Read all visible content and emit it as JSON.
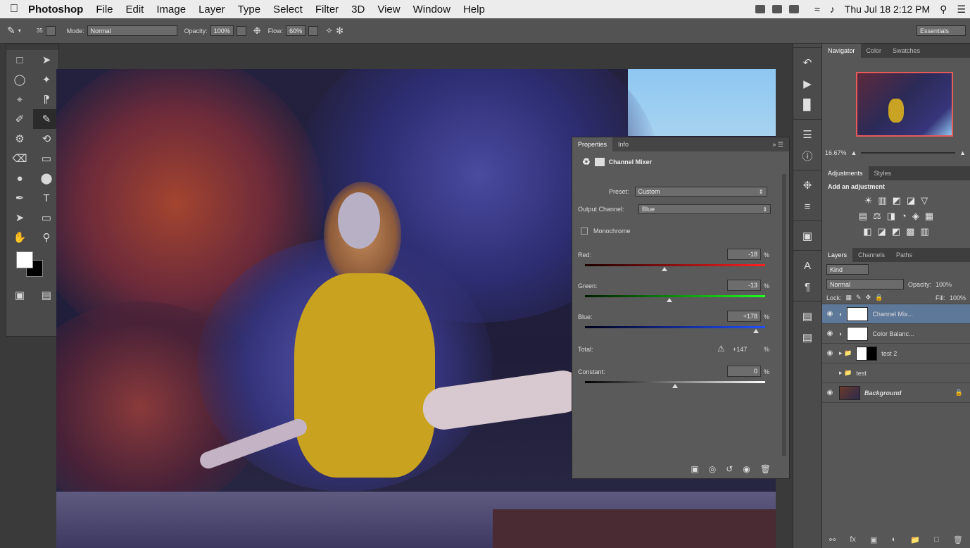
{
  "menubar": {
    "app_name": "Photoshop",
    "items": [
      "File",
      "Edit",
      "Image",
      "Layer",
      "Type",
      "Select",
      "Filter",
      "3D",
      "View",
      "Window",
      "Help"
    ],
    "clock": "Thu Jul 18  2:12 PM"
  },
  "options_bar": {
    "brush_size": "35",
    "mode_label": "Mode:",
    "mode_value": "Normal",
    "opacity_label": "Opacity:",
    "opacity_value": "100%",
    "flow_label": "Flow:",
    "flow_value": "60%",
    "workspace": "Essentials"
  },
  "properties_panel": {
    "tabs": [
      "Properties",
      "Info"
    ],
    "title": "Channel Mixer",
    "preset_label": "Preset:",
    "preset_value": "Custom",
    "output_label": "Output Channel:",
    "output_value": "Blue",
    "monochrome_label": "Monochrome",
    "sliders": [
      {
        "label": "Red:",
        "value": "-18",
        "thumb_fraction": 0.44,
        "gradient": "linear-gradient(90deg,#1a0000,#ff2020)"
      },
      {
        "label": "Green:",
        "value": "-13",
        "thumb_fraction": 0.47,
        "gradient": "linear-gradient(90deg,#001a00,#20ff20)"
      },
      {
        "label": "Blue:",
        "value": "+178",
        "thumb_fraction": 0.95,
        "gradient": "linear-gradient(90deg,#00001a,#2050ff)"
      }
    ],
    "total_label": "Total:",
    "total_value": "+147",
    "constant_label": "Constant:",
    "constant_value": "0",
    "constant_thumb_fraction": 0.5,
    "percent": "%"
  },
  "navigator": {
    "tabs": [
      "Navigator",
      "Color",
      "Swatches"
    ],
    "zoom": "16.67%"
  },
  "adjustments": {
    "tabs": [
      "Adjustments",
      "Styles"
    ],
    "title": "Add an adjustment",
    "rows": [
      [
        "☀",
        "▥",
        "◩",
        "◪",
        "▽"
      ],
      [
        "▤",
        "⚖",
        "◨",
        "◔",
        "◈",
        "▦"
      ],
      [
        "◧",
        "◪",
        "◩",
        "▩",
        "▥"
      ]
    ]
  },
  "layers_panel": {
    "tabs": [
      "Layers",
      "Channels",
      "Paths"
    ],
    "kind_filter": "Kind",
    "blend_mode": "Normal",
    "opacity_label": "Opacity:",
    "opacity_value": "100%",
    "lock_label": "Lock:",
    "fill_label": "Fill:",
    "fill_value": "100%",
    "layers": [
      {
        "name": "Channel Mix...",
        "type": "adjustment"
      },
      {
        "name": "Color Balanc...",
        "type": "adjustment"
      },
      {
        "name": "test 2",
        "type": "group"
      },
      {
        "name": "test",
        "type": "group"
      },
      {
        "name": "Background",
        "type": "image"
      }
    ]
  }
}
